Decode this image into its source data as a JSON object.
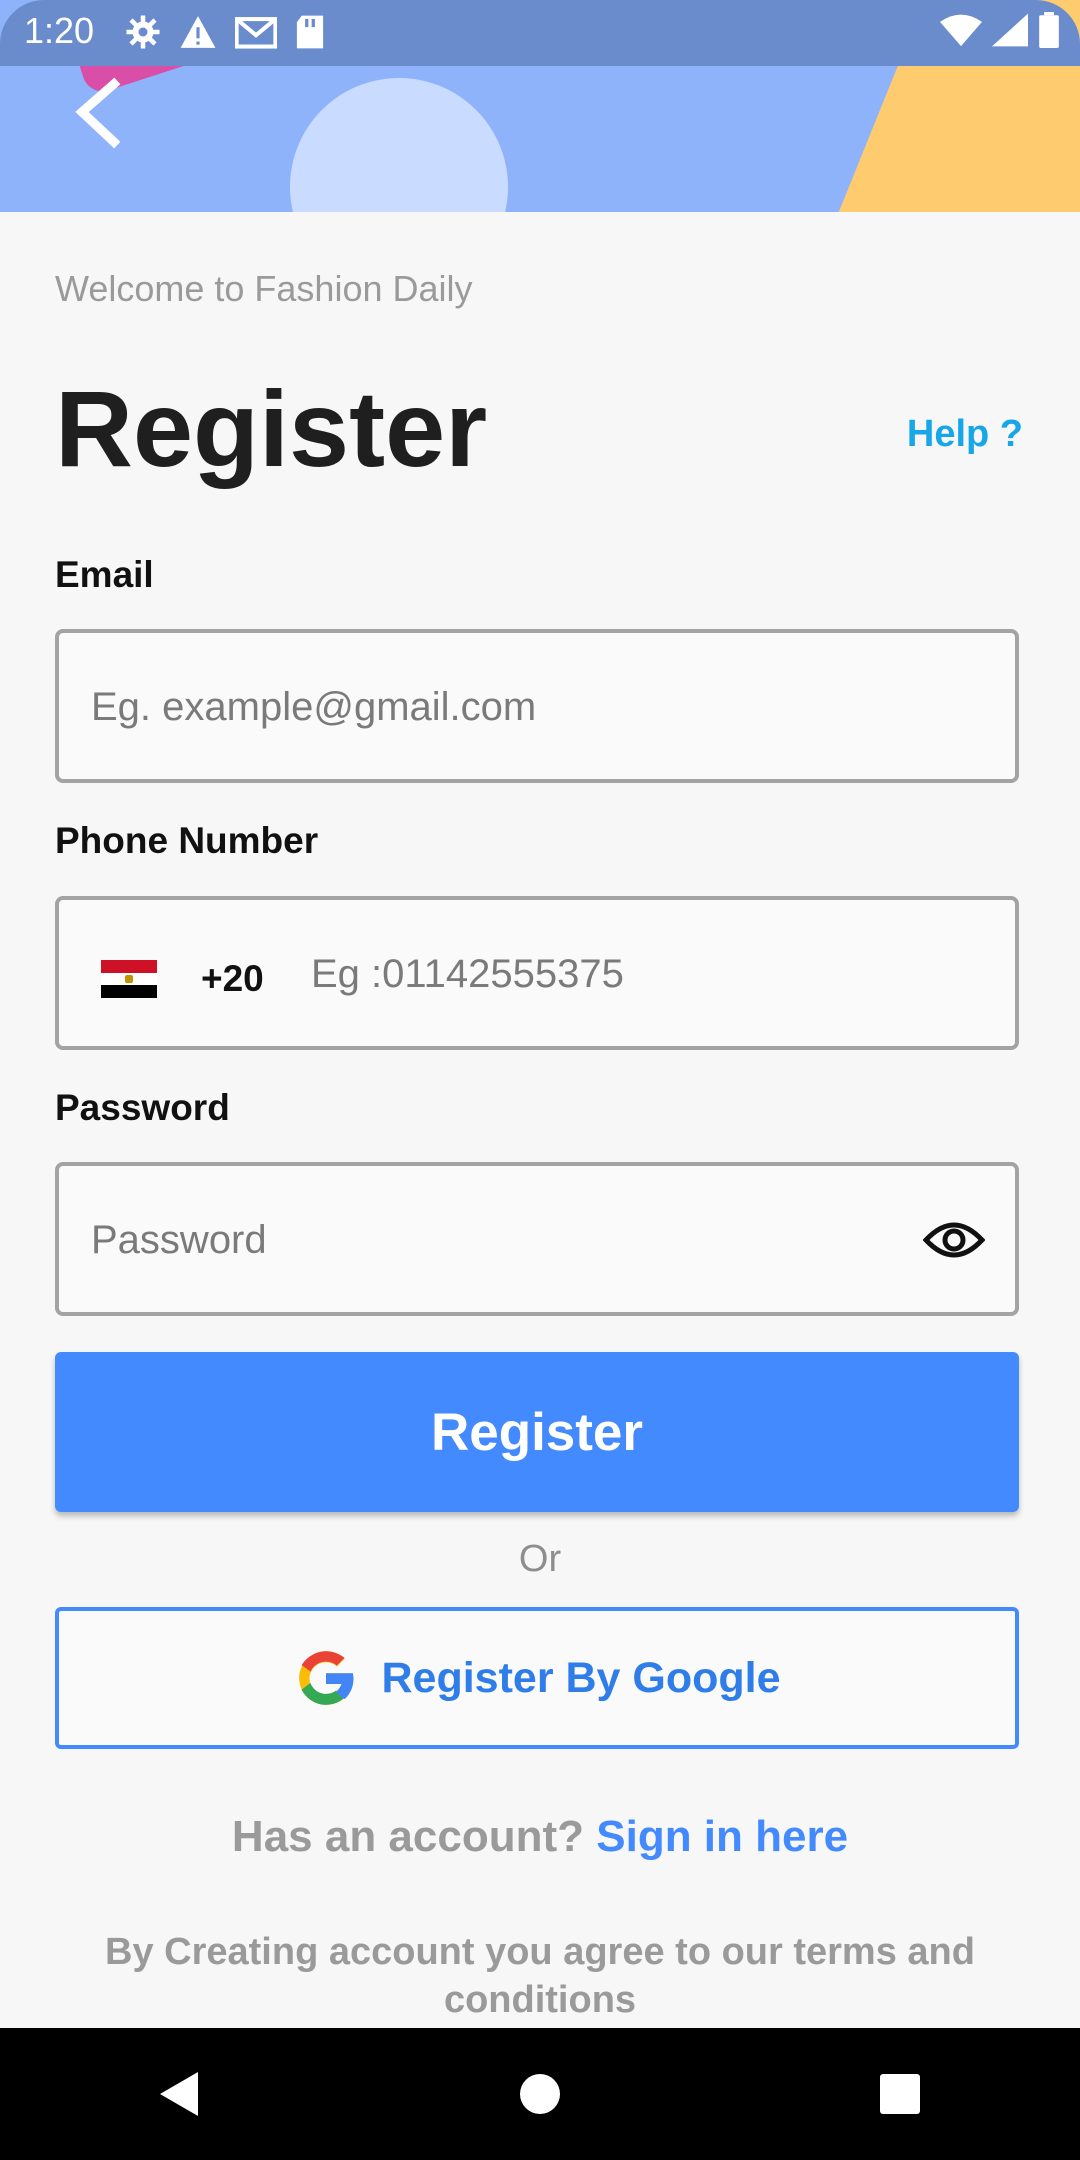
{
  "status_bar": {
    "time": "1:20",
    "icons": [
      "settings-icon",
      "warning-icon",
      "gmail-icon",
      "sd-card-icon",
      "wifi-icon",
      "signal-icon",
      "battery-icon"
    ]
  },
  "header": {
    "back_icon": "chevron-left-icon"
  },
  "welcome_text": "Welcome to Fashion Daily",
  "title": "Register",
  "help_link": "Help ?",
  "email": {
    "label": "Email",
    "placeholder": "Eg. example@gmail.com",
    "value": ""
  },
  "phone": {
    "label": "Phone Number",
    "country_code": "+20",
    "flag_icon": "egypt-flag-icon",
    "placeholder": "Eg :01142555375",
    "value": ""
  },
  "password": {
    "label": "Password",
    "placeholder": "Password",
    "value": "",
    "toggle_icon": "eye-icon"
  },
  "register_button": "Register",
  "or_text": "Or",
  "google_button": {
    "label": "Register By Google",
    "icon": "google-icon"
  },
  "account_prompt": {
    "text": "Has an account?",
    "link": "Sign in here"
  },
  "terms_text": "By Creating account you agree to our terms and conditions",
  "nav": {
    "back": "back-triangle-icon",
    "home": "home-circle-icon",
    "recents": "recents-square-icon"
  },
  "colors": {
    "primary": "#448aff",
    "help": "#17a6e8",
    "header": "#8fb3fb",
    "muted": "#9a9a9a"
  }
}
